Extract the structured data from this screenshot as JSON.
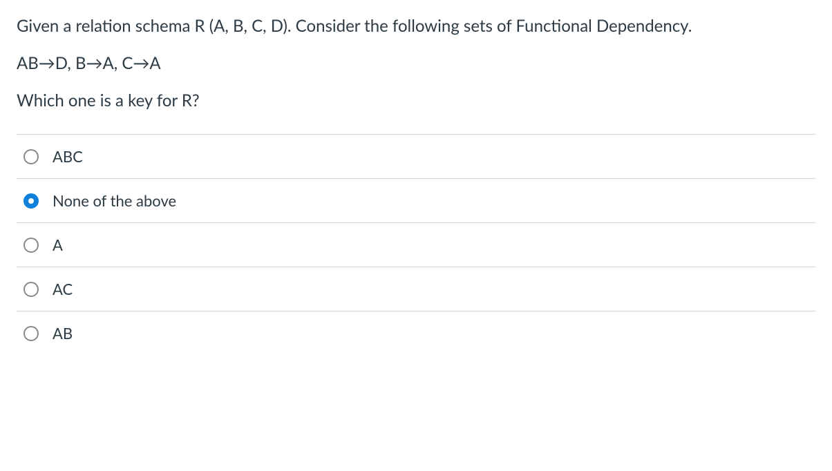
{
  "question": {
    "line1": "Given a relation schema R (A, B, C, D). Consider the following sets of Functional Dependency.",
    "line2": "AB→D, B→A, C→A",
    "line3": "Which one is a key for R?"
  },
  "options": [
    {
      "label": "ABC",
      "selected": false
    },
    {
      "label": "None of the above",
      "selected": true
    },
    {
      "label": "A",
      "selected": false
    },
    {
      "label": "AC",
      "selected": false
    },
    {
      "label": "AB",
      "selected": false
    }
  ]
}
